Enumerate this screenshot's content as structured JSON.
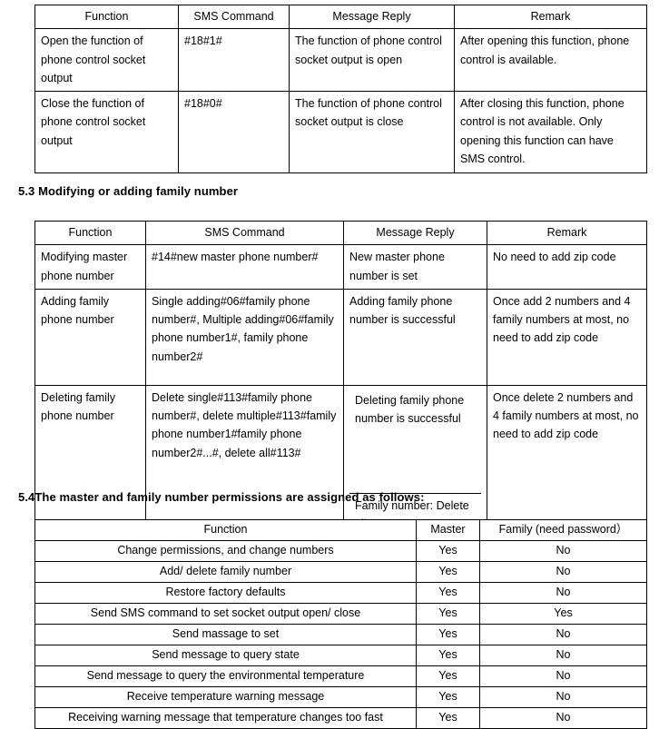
{
  "document": {
    "sections": [
      {
        "id": "5.2-table",
        "heading": null,
        "table": {
          "name": "socket-output-sms-table",
          "columns": [
            "Function",
            "SMS Command",
            "Message Reply",
            "Remark"
          ],
          "rows": [
            {
              "function": "Open the function of phone control socket output",
              "sms_command": "#18#1#",
              "message_reply": "The function of phone control socket output is open",
              "remark": "After opening this function, phone control is available."
            },
            {
              "function": "Close the function of phone control socket output",
              "sms_command": "#18#0#",
              "message_reply": "The function of phone control socket output is close",
              "remark": "After closing this function, phone control is not available. Only opening this function can have SMS control."
            }
          ]
        }
      },
      {
        "id": "5.3",
        "heading": "5.3 Modifying or adding family number",
        "table": {
          "name": "family-number-table",
          "columns": [
            "Function",
            "SMS Command",
            "Message Reply",
            "Remark"
          ],
          "rows": [
            {
              "function": "Modifying master phone number",
              "sms_command": "#14#new master phone number#",
              "message_reply": "New master phone number is set",
              "remark": "No need to add zip code"
            },
            {
              "function": "Adding family phone number",
              "sms_command": "Single adding#06#family phone number#, Multiple adding#06#family phone number1#, family phone number2#",
              "message_reply": "Adding family phone number is successful",
              "remark": "Once add 2 numbers and 4 family numbers at most, no need to add zip code"
            },
            {
              "function": "Deleting family phone number",
              "sms_command": "Delete single#113#family phone number#, delete multiple#113#family phone number1#family phone number2#...#, delete all#113#",
              "message_reply_primary": "Deleting family phone number is successful",
              "message_reply_secondary": "Family number: Delete all",
              "remark": "Once delete 2 numbers and 4 family numbers at most, no need to add zip code"
            }
          ]
        }
      },
      {
        "id": "5.4",
        "heading": "5.4The master and family number permissions are assigned as follows:",
        "table": {
          "name": "permissions-table",
          "columns": [
            "Function",
            "Master",
            "Family (need password）"
          ],
          "rows": [
            {
              "function": "Change permissions, and change numbers",
              "master": "Yes",
              "family": "No"
            },
            {
              "function": "Add/ delete family number",
              "master": "Yes",
              "family": "No"
            },
            {
              "function": "Restore factory defaults",
              "master": "Yes",
              "family": "No"
            },
            {
              "function": "Send SMS command to set socket output open/ close",
              "master": "Yes",
              "family": "Yes"
            },
            {
              "function": "Send massage to set",
              "master": "Yes",
              "family": "No"
            },
            {
              "function": "Send message to query state",
              "master": "Yes",
              "family": "No"
            },
            {
              "function": "Send message to query the environmental temperature",
              "master": "Yes",
              "family": "No"
            },
            {
              "function": "Receive temperature warning message",
              "master": "Yes",
              "family": "No"
            },
            {
              "function": "Receiving warning message that temperature changes too fast",
              "master": "Yes",
              "family": "No"
            }
          ]
        }
      }
    ]
  }
}
